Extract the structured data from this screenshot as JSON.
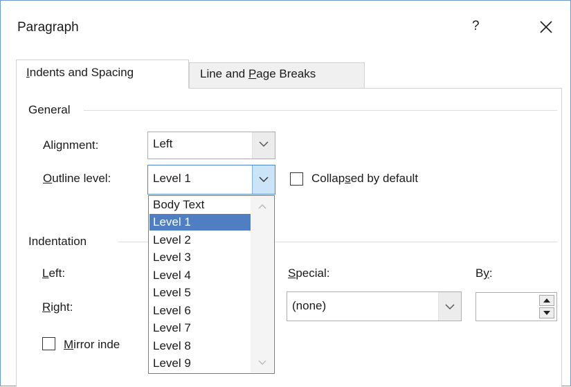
{
  "dialog": {
    "title": "Paragraph",
    "help_label": "?"
  },
  "tabs": [
    {
      "pre": "",
      "key": "I",
      "post": "ndents and Spacing",
      "active": true
    },
    {
      "pre": "Line and ",
      "key": "P",
      "post": "age Breaks",
      "active": false
    }
  ],
  "general": {
    "group_label": "General",
    "alignment": {
      "pre": "Ali",
      "key": "g",
      "post": "nment:",
      "value": "Left"
    },
    "outline_level": {
      "pre": "",
      "key": "O",
      "post": "utline level:",
      "value": "Level 1"
    },
    "collapsed": {
      "pre": "Collap",
      "key": "s",
      "post": "ed by default",
      "checked": false
    }
  },
  "indentation": {
    "group_label": "Indentation",
    "left": {
      "pre": "",
      "key": "L",
      "post": "eft:"
    },
    "right": {
      "pre": "",
      "key": "R",
      "post": "ight:"
    },
    "special": {
      "pre": "",
      "key": "S",
      "post": "pecial:",
      "value": "(none)"
    },
    "by": {
      "pre": "B",
      "key": "y",
      "post": ":",
      "value": ""
    },
    "mirror": {
      "pre": "",
      "key": "M",
      "post": "irror inde",
      "checked": false
    }
  },
  "outline_dropdown": {
    "options": [
      "Body Text",
      "Level 1",
      "Level 2",
      "Level 3",
      "Level 4",
      "Level 5",
      "Level 6",
      "Level 7",
      "Level 8",
      "Level 9"
    ],
    "selected_index": 1
  },
  "colors": {
    "selection": "#4f7fc2",
    "dialog_border": "#6f98c6",
    "active_arrow": "#cce4f7"
  }
}
